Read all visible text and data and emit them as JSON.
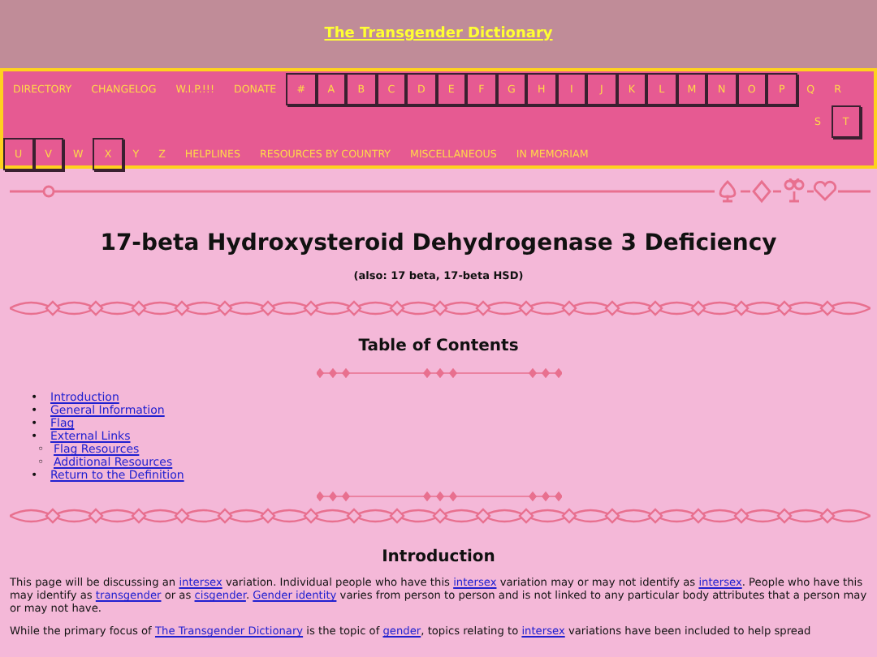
{
  "site_title": "The Transgender Dictionary",
  "nav": {
    "rows": [
      {
        "kind": "start",
        "items": [
          {
            "label": "DIRECTORY",
            "boxed": false
          },
          {
            "label": "CHANGELOG",
            "boxed": false
          },
          {
            "label": "W.I.P.!!!",
            "boxed": false
          },
          {
            "label": "DONATE",
            "boxed": false
          },
          {
            "label": "#",
            "boxed": true
          },
          {
            "label": "A",
            "boxed": true
          },
          {
            "label": "B",
            "boxed": true
          },
          {
            "label": "C",
            "boxed": true
          },
          {
            "label": "D",
            "boxed": true
          },
          {
            "label": "E",
            "boxed": true
          },
          {
            "label": "F",
            "boxed": true
          },
          {
            "label": "G",
            "boxed": true
          },
          {
            "label": "H",
            "boxed": true
          },
          {
            "label": "I",
            "boxed": true
          },
          {
            "label": "J",
            "boxed": true
          },
          {
            "label": "K",
            "boxed": true
          },
          {
            "label": "L",
            "boxed": true
          },
          {
            "label": "M",
            "boxed": true
          },
          {
            "label": "N",
            "boxed": true
          },
          {
            "label": "O",
            "boxed": true
          },
          {
            "label": "P",
            "boxed": true
          },
          {
            "label": "Q",
            "boxed": false
          },
          {
            "label": "R",
            "boxed": false
          }
        ]
      },
      {
        "kind": "end",
        "items": [
          {
            "label": "S",
            "boxed": false
          },
          {
            "label": "T",
            "boxed": true
          }
        ]
      },
      {
        "kind": "start",
        "items": [
          {
            "label": "U",
            "boxed": true
          },
          {
            "label": "V",
            "boxed": true
          },
          {
            "label": "W",
            "boxed": false
          },
          {
            "label": "X",
            "boxed": true
          },
          {
            "label": "Y",
            "boxed": false
          },
          {
            "label": "Z",
            "boxed": false
          },
          {
            "label": "HELPLINES",
            "boxed": false
          },
          {
            "label": "RESOURCES BY COUNTRY",
            "boxed": false
          },
          {
            "label": "MISCELLANEOUS",
            "boxed": false
          },
          {
            "label": "IN MEMORIAM",
            "boxed": false
          }
        ]
      }
    ]
  },
  "title": "17-beta Hydroxysteroid Dehydrogenase 3 Deficiency",
  "subtitle": "(also: 17 beta, 17-beta HSD)",
  "toc": {
    "heading": "Table of Contents",
    "items": [
      {
        "marker": "•",
        "label": "Introduction"
      },
      {
        "marker": "•",
        "label": "General Information"
      },
      {
        "marker": "•",
        "label": "Flag"
      },
      {
        "marker": "•",
        "label": "External Links",
        "children": [
          {
            "marker": "◦",
            "label": "Flag Resources"
          },
          {
            "marker": "◦",
            "label": "Additional Resources"
          }
        ]
      },
      {
        "marker": "•",
        "label": "Return to the Definition"
      }
    ]
  },
  "section": {
    "heading": "Introduction",
    "paragraphs": [
      [
        {
          "text": "This page will be discussing an "
        },
        {
          "text": "intersex",
          "link": true
        },
        {
          "text": " variation. Individual people who have this "
        },
        {
          "text": "intersex",
          "link": true
        },
        {
          "text": " variation may or may not identify as "
        },
        {
          "text": "intersex",
          "link": true
        },
        {
          "text": ". People who have this may identify as "
        },
        {
          "text": "transgender",
          "link": true
        },
        {
          "text": " or as "
        },
        {
          "text": "cisgender",
          "link": true
        },
        {
          "text": ". "
        },
        {
          "text": "Gender identity",
          "link": true
        },
        {
          "text": " varies from person to person and is not linked to any particular body attributes that a person may or may not have."
        }
      ],
      [
        {
          "text": "While the primary focus of "
        },
        {
          "text": "The Transgender Dictionary",
          "link": true
        },
        {
          "text": " is the topic of "
        },
        {
          "text": "gender",
          "link": true
        },
        {
          "text": ", topics relating to "
        },
        {
          "text": "intersex",
          "link": true
        },
        {
          "text": " variations have been included to help spread"
        }
      ]
    ]
  }
}
